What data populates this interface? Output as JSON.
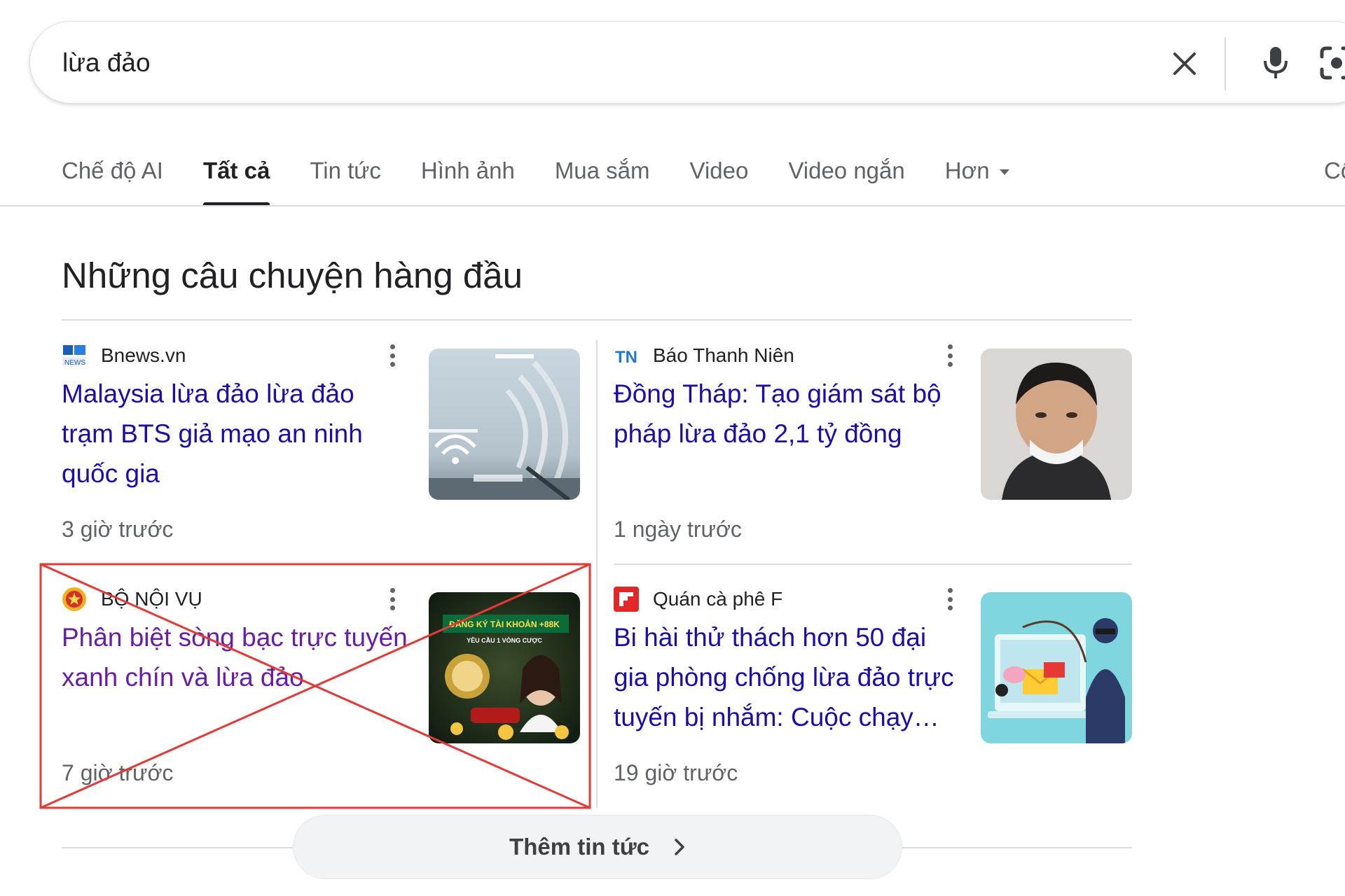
{
  "search": {
    "query": "lừa đảo",
    "clear_icon": "close-icon",
    "mic_icon": "microphone-icon",
    "lens_icon": "lens-camera-icon"
  },
  "tabs": [
    {
      "label": "Chế độ AI",
      "active": false
    },
    {
      "label": "Tất cả",
      "active": true
    },
    {
      "label": "Tin tức",
      "active": false
    },
    {
      "label": "Hình ảnh",
      "active": false
    },
    {
      "label": "Mua sắm",
      "active": false
    },
    {
      "label": "Video",
      "active": false
    },
    {
      "label": "Video ngắn",
      "active": false
    },
    {
      "label": "Hơn",
      "active": false
    }
  ],
  "tools_tab": "Cô",
  "section": {
    "title": "Những câu chuyện hàng đầu"
  },
  "stories": [
    {
      "source": "Bnews.vn",
      "headline": "Malaysia lừa đảo lừa đảo trạm BTS giả mạo an ninh quốc gia",
      "time": "3 giờ trước",
      "favicon": "bnews-logo",
      "thumb": "wifi-signal-photo"
    },
    {
      "source": "Báo Thanh Niên",
      "headline": "Đồng Tháp: Tạo giám sát bộ pháp lừa đảo 2,1 tỷ đồng",
      "time": "1 ngày trước",
      "favicon": "thanhnien-logo",
      "thumb": "woman-portrait-photo"
    },
    {
      "source": "BỘ NỘI VỤ",
      "headline": "Phân biệt sòng bạc trực tuyến xanh chín và lừa đảo",
      "time": "7 giờ trước",
      "favicon": "national-emblem-icon",
      "thumb": "casino-ad-image",
      "thumb_text": "ĐĂNG KÝ TÀI KHOẢN +88K",
      "thumb_subtext": "YÊU CẦU 1 VÒNG CƯỢC",
      "visited": true,
      "crossed_out": true
    },
    {
      "source": "Quán cà phê F",
      "headline": "Bi hài thử thách hơn 50 đại gia phòng chống lừa đảo trực tuyến bị nhắm: Cuộc chạy…",
      "time": "19 giờ trước",
      "favicon": "flipboard-logo",
      "thumb": "phishing-illustration"
    }
  ],
  "more_news": {
    "label": "Thêm tin tức",
    "icon": "chevron-right-icon"
  },
  "colors": {
    "link": "#1a0dab",
    "visited": "#681da8",
    "muted": "#5f6368",
    "cross": "#e53935"
  }
}
